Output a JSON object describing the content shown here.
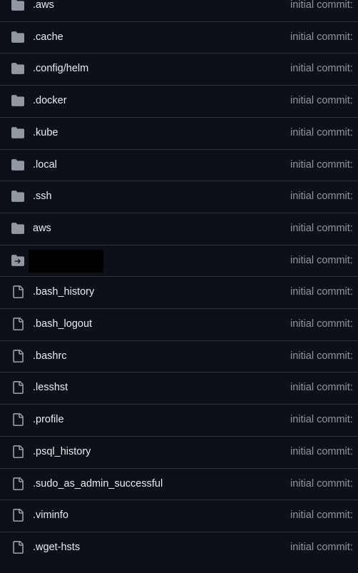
{
  "colors": {
    "background": "#0d1117",
    "border": "#30363d",
    "text": "#e6edf3",
    "muted": "#8d96a0",
    "dir_icon": "#9198a1",
    "file_icon": "#9198a1"
  },
  "entries": [
    {
      "name": ".aws",
      "type": "folder-icon",
      "commit": "initial commit:"
    },
    {
      "name": ".cache",
      "type": "folder-icon",
      "commit": "initial commit:"
    },
    {
      "name": ".config/helm",
      "type": "folder-icon",
      "commit": "initial commit:"
    },
    {
      "name": ".docker",
      "type": "folder-icon",
      "commit": "initial commit:"
    },
    {
      "name": ".kube",
      "type": "folder-icon",
      "commit": "initial commit:"
    },
    {
      "name": ".local",
      "type": "folder-icon",
      "commit": "initial commit:"
    },
    {
      "name": ".ssh",
      "type": "folder-icon",
      "commit": "initial commit:"
    },
    {
      "name": "aws",
      "type": "folder-icon",
      "commit": "initial commit:"
    },
    {
      "name": "",
      "type": "symlink-folder-icon",
      "commit": "initial commit:",
      "redacted": true
    },
    {
      "name": ".bash_history",
      "type": "file-icon",
      "commit": "initial commit:"
    },
    {
      "name": ".bash_logout",
      "type": "file-icon",
      "commit": "initial commit:"
    },
    {
      "name": ".bashrc",
      "type": "file-icon",
      "commit": "initial commit:"
    },
    {
      "name": ".lesshst",
      "type": "file-icon",
      "commit": "initial commit:"
    },
    {
      "name": ".profile",
      "type": "file-icon",
      "commit": "initial commit:"
    },
    {
      "name": ".psql_history",
      "type": "file-icon",
      "commit": "initial commit:"
    },
    {
      "name": ".sudo_as_admin_successful",
      "type": "file-icon",
      "commit": "initial commit:"
    },
    {
      "name": ".viminfo",
      "type": "file-icon",
      "commit": "initial commit:"
    },
    {
      "name": ".wget-hsts",
      "type": "file-icon",
      "commit": "initial commit:"
    }
  ]
}
